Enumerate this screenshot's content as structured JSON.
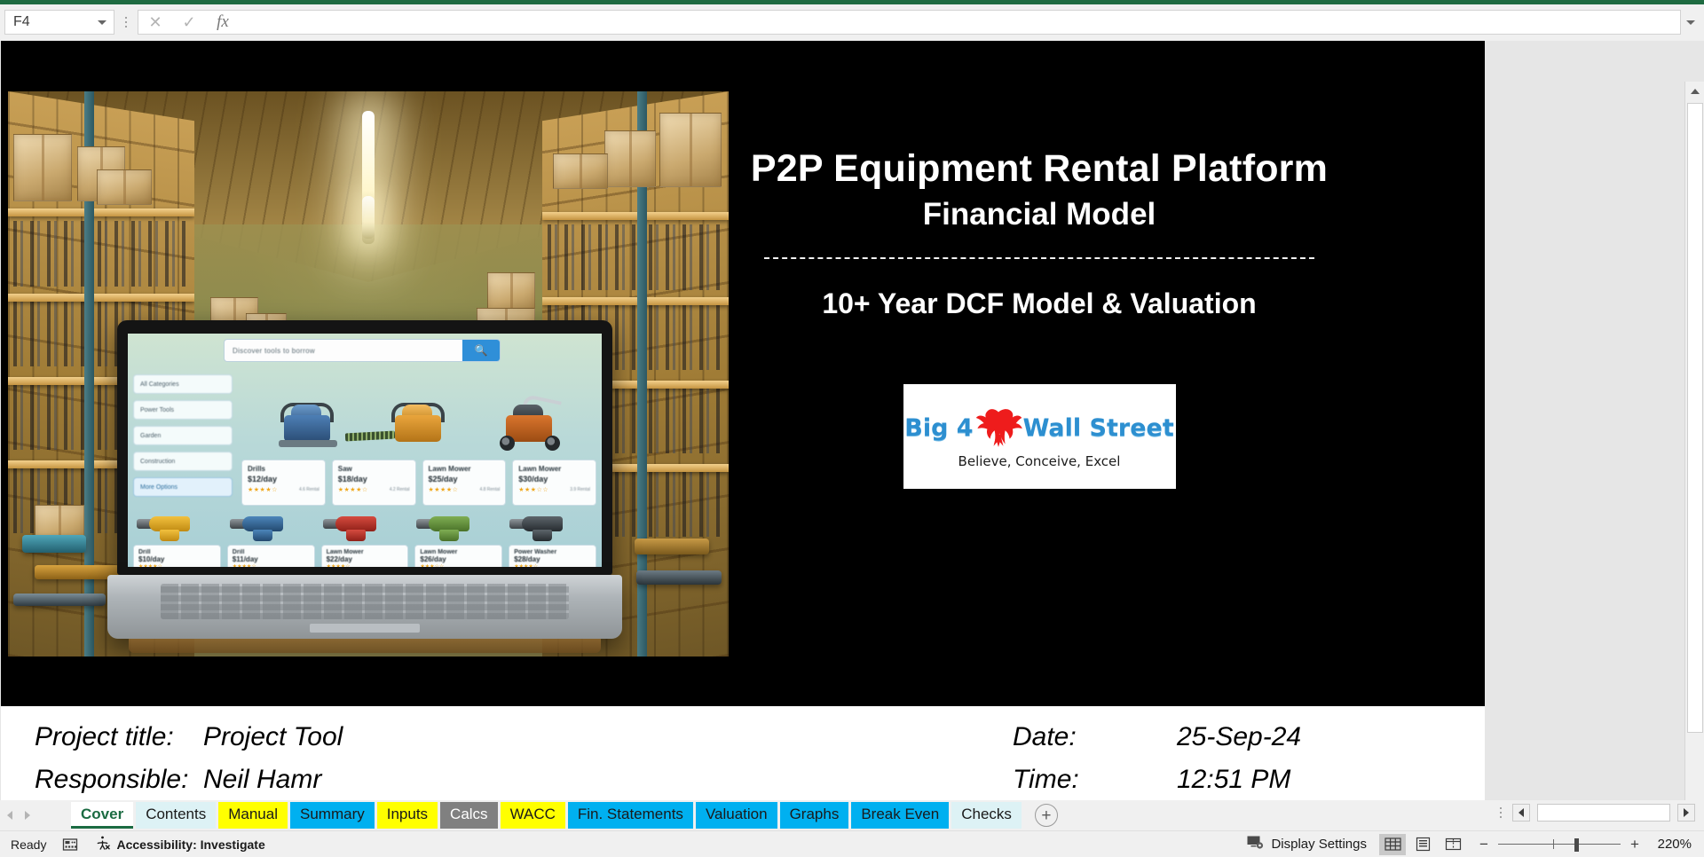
{
  "app": {
    "name_box_value": "F4",
    "formula_value": "",
    "formula_cancel_icon": "cancel-icon",
    "formula_confirm_icon": "confirm-icon",
    "formula_fx_icon": "insert-function-icon"
  },
  "slide": {
    "main_title": "P2P Equipment Rental Platform",
    "sub_title": "Financial Model",
    "divider": "----------------------------------------------------",
    "tagline": "10+ Year DCF Model & Valuation",
    "logo": {
      "word1": "Big 4",
      "word2": "Wall Street",
      "motto": "Believe, Conceive, Excel",
      "eagle_icon": "eagle-icon",
      "brand_color": "#2d8fd0",
      "eagle_color": "#ee1c1c"
    },
    "hero_image": {
      "alt": "warehouse-with-laptop-rental-marketplace",
      "laptop_search_placeholder": "Discover tools to borrow",
      "laptop_search_icon": "search-icon",
      "sidebar_items": [
        "All Categories",
        "Power Tools",
        "Garden",
        "Construction",
        "More Options"
      ],
      "cards": [
        {
          "title": "Drills",
          "price": "$12/day",
          "stars": "★★★★☆",
          "meta": "4.6  Rental"
        },
        {
          "title": "Saw",
          "price": "$18/day",
          "stars": "★★★★☆",
          "meta": "4.2  Rental"
        },
        {
          "title": "Lawn Mower",
          "price": "$25/day",
          "stars": "★★★★☆",
          "meta": "4.8  Rental"
        },
        {
          "title": "Lawn Mower",
          "price": "$30/day",
          "stars": "★★★☆☆",
          "meta": "3.9  Rental"
        }
      ],
      "cards2": [
        {
          "title": "Drill",
          "price": "$10/day",
          "stars": "★★★★☆"
        },
        {
          "title": "Drill",
          "price": "$11/day",
          "stars": "★★★★☆"
        },
        {
          "title": "Lawn Mower",
          "price": "$22/day",
          "stars": "★★★★☆"
        },
        {
          "title": "Lawn Mower",
          "price": "$26/day",
          "stars": "★★★☆☆"
        },
        {
          "title": "Power Washer",
          "price": "$28/day",
          "stars": "★★★★☆"
        }
      ]
    }
  },
  "info": {
    "project_title_label": "Project title:",
    "project_title_value": "Project Tool",
    "responsible_label": "Responsible:",
    "responsible_value": "Neil Hamr",
    "date_label": "Date:",
    "date_value": "25-Sep-24",
    "time_label": "Time:",
    "time_value": "12:51 PM"
  },
  "tabs": {
    "prev_icon": "chevron-left-icon",
    "next_icon": "chevron-right-icon",
    "add_label": "+",
    "items": [
      {
        "label": "Cover",
        "bg": "#ffffff",
        "fg": "#1b6b42",
        "active": true
      },
      {
        "label": "Contents",
        "bg": "#ddf2f5",
        "fg": "#1a1a1a",
        "active": false
      },
      {
        "label": "Manual",
        "bg": "#ffff00",
        "fg": "#1a1a1a",
        "active": false
      },
      {
        "label": "Summary",
        "bg": "#00b0f0",
        "fg": "#1a1a1a",
        "active": false
      },
      {
        "label": "Inputs",
        "bg": "#ffff00",
        "fg": "#1a1a1a",
        "active": false
      },
      {
        "label": "Calcs",
        "bg": "#808080",
        "fg": "#ffffff",
        "active": false
      },
      {
        "label": "WACC",
        "bg": "#ffff00",
        "fg": "#1a1a1a",
        "active": false
      },
      {
        "label": "Fin. Statements",
        "bg": "#00b0f0",
        "fg": "#1a1a1a",
        "active": false
      },
      {
        "label": "Valuation",
        "bg": "#00b0f0",
        "fg": "#1a1a1a",
        "active": false
      },
      {
        "label": "Graphs",
        "bg": "#00b0f0",
        "fg": "#1a1a1a",
        "active": false
      },
      {
        "label": "Break Even",
        "bg": "#00b0f0",
        "fg": "#1a1a1a",
        "active": false
      },
      {
        "label": "Checks",
        "bg": "#ddf2f5",
        "fg": "#1a1a1a",
        "active": false
      }
    ]
  },
  "status": {
    "ready_label": "Ready",
    "macro_icon": "record-macro-icon",
    "accessibility_icon": "accessibility-icon",
    "accessibility_label": "Accessibility: Investigate",
    "display_settings_icon": "display-settings-icon",
    "display_settings_label": "Display Settings",
    "view_normal_icon": "normal-view-icon",
    "view_pagelayout_icon": "page-layout-view-icon",
    "view_pagebreak_icon": "page-break-preview-icon",
    "zoom_out_label": "−",
    "zoom_in_label": "+",
    "zoom_percent": "220%"
  }
}
